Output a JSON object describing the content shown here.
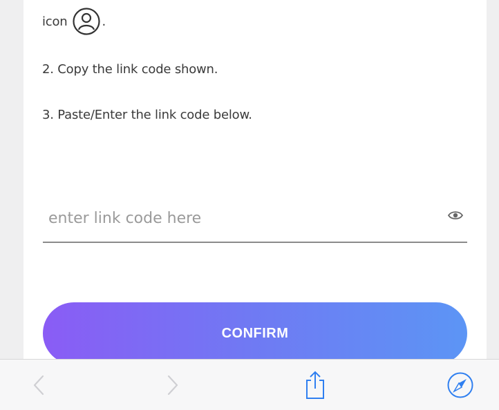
{
  "instructions": {
    "step1_word": "icon",
    "step1_suffix": ".",
    "step2": "2. Copy the link code shown.",
    "step3": "3. Paste/Enter the link code below."
  },
  "link_code_input": {
    "value": "",
    "placeholder": "enter link code here"
  },
  "confirm_button": {
    "label": "CONFIRM"
  },
  "colors": {
    "button_gradient_start": "#8a5cf5",
    "button_gradient_end": "#5c95f5",
    "safari_accent": "#2f7ff0"
  },
  "browser_toolbar": {
    "icons": [
      "back-icon",
      "forward-icon",
      "share-icon",
      "safari-compass-icon"
    ]
  }
}
